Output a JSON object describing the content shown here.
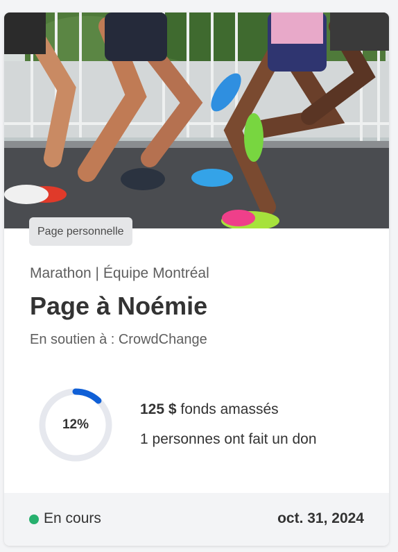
{
  "card": {
    "badge": "Page personnelle",
    "event": "Marathon | Équipe Montréal",
    "title": "Page à Noémie",
    "support": "En soutien à : CrowdChange"
  },
  "progress": {
    "percent_label": "12%",
    "fraction": 0.12,
    "amount": "125 $",
    "amount_suffix": " fonds amassés",
    "donors_text": "1 personnes ont fait un don"
  },
  "footer": {
    "status": "En cours",
    "date": "oct. 31, 2024"
  },
  "colors": {
    "accent": "#0f5fd6",
    "ring_track": "#e6e8ee",
    "status": "#27b06e"
  },
  "image": {
    "subject": "runners-legs-photo"
  }
}
